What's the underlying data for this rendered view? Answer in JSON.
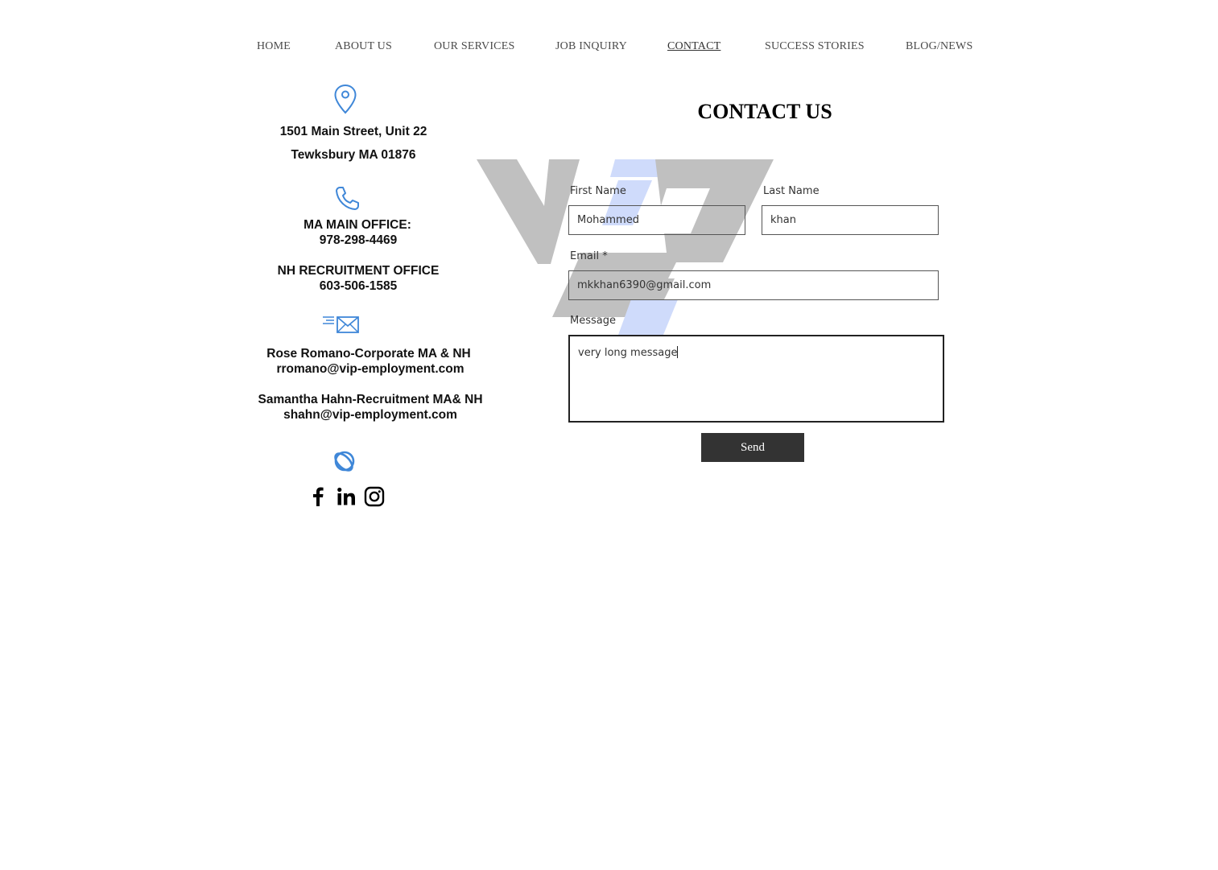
{
  "nav": {
    "items": [
      {
        "label": "HOME"
      },
      {
        "label": "ABOUT US"
      },
      {
        "label": "OUR SERVICES"
      },
      {
        "label": "JOB INQUIRY"
      },
      {
        "label": "CONTACT",
        "active": true
      },
      {
        "label": "SUCCESS STORIES"
      },
      {
        "label": "BLOG/NEWS"
      }
    ]
  },
  "contact_info": {
    "address_line1": "1501 Main Street, Unit 22",
    "address_line2": "Tewksbury MA 01876",
    "ma_office_label": "MA MAIN OFFICE:",
    "ma_office_phone": "978-298-4469",
    "nh_office_label": "NH RECRUITMENT OFFICE",
    "nh_office_phone": "603-506-1585",
    "contact1_name": "Rose Romano-Corporate MA & NH",
    "contact1_email": "rromano@vip-employment.com",
    "contact2_name": "Samantha Hahn-Recruitment MA& NH",
    "contact2_email": "shahn@vip-employment.com"
  },
  "icons": {
    "address": "map-pin-icon",
    "phone": "phone-icon",
    "email": "envelope-icon",
    "social": "social-links-icon",
    "facebook": "facebook-icon",
    "linkedin": "linkedin-icon",
    "instagram": "instagram-icon"
  },
  "form": {
    "title": "CONTACT US",
    "first_name_label": "First Name",
    "first_name_value": "Mohammed",
    "last_name_label": "Last Name",
    "last_name_value": "khan",
    "email_label": "Email *",
    "email_value": "mkkhan6390@gmail.com",
    "message_label": "Message",
    "message_value": "very long message",
    "send_label": "Send"
  },
  "colors": {
    "icon_blue": "#3f87d8",
    "button_bg": "#333333",
    "logo_gray": "#c0c0c0",
    "logo_blue": "#cfdbfb"
  }
}
